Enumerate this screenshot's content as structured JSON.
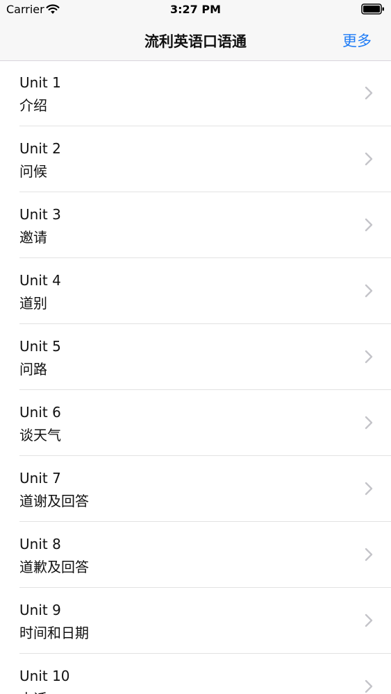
{
  "status_bar": {
    "carrier": "Carrier",
    "time": "3:27 PM"
  },
  "nav": {
    "title": "流利英语口语通",
    "more_label": "更多",
    "accent_color": "#1f7cf6"
  },
  "units": [
    {
      "title": "Unit 1",
      "subtitle": "介绍"
    },
    {
      "title": "Unit 2",
      "subtitle": "问候"
    },
    {
      "title": "Unit 3",
      "subtitle": "邀请"
    },
    {
      "title": "Unit 4",
      "subtitle": "道别"
    },
    {
      "title": "Unit 5",
      "subtitle": "问路"
    },
    {
      "title": "Unit 6",
      "subtitle": "谈天气"
    },
    {
      "title": "Unit 7",
      "subtitle": "道谢及回答"
    },
    {
      "title": "Unit 8",
      "subtitle": "道歉及回答"
    },
    {
      "title": "Unit 9",
      "subtitle": "时间和日期"
    },
    {
      "title": "Unit 10",
      "subtitle": "电话"
    }
  ]
}
